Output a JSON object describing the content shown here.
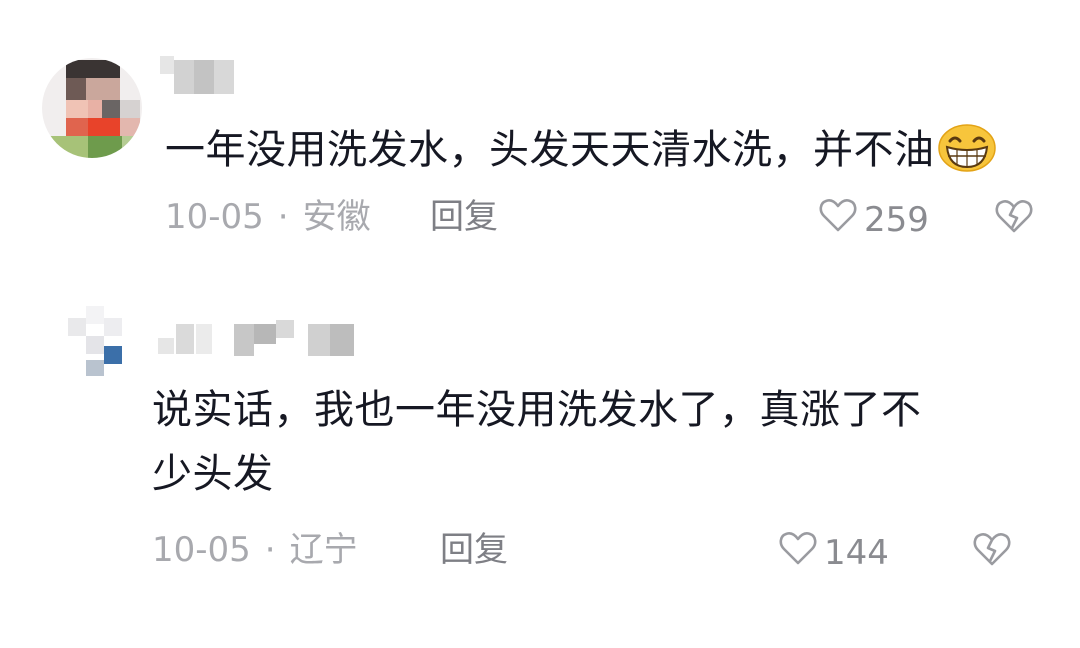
{
  "comments": [
    {
      "text": "一年没用洗发水，头发天天清水洗，并不油",
      "emoji": "grinning-face-emoji",
      "date": "10-05",
      "separator": "·",
      "location": "安徽",
      "reply_label": "回复",
      "likes": "259"
    },
    {
      "text_line1": "说实话，我也一年没用洗发水了，真涨了不",
      "text_line2": "少头发",
      "date": "10-05",
      "separator": "·",
      "location": "辽宁",
      "reply_label": "回复",
      "likes": "144"
    }
  ],
  "icons": {
    "like": "heart-outline-icon",
    "dislike": "broken-heart-icon"
  },
  "colors": {
    "text": "#161823",
    "meta": "#a8a9ae",
    "reply": "#7e7f85",
    "icon": "#9a9ba0"
  }
}
